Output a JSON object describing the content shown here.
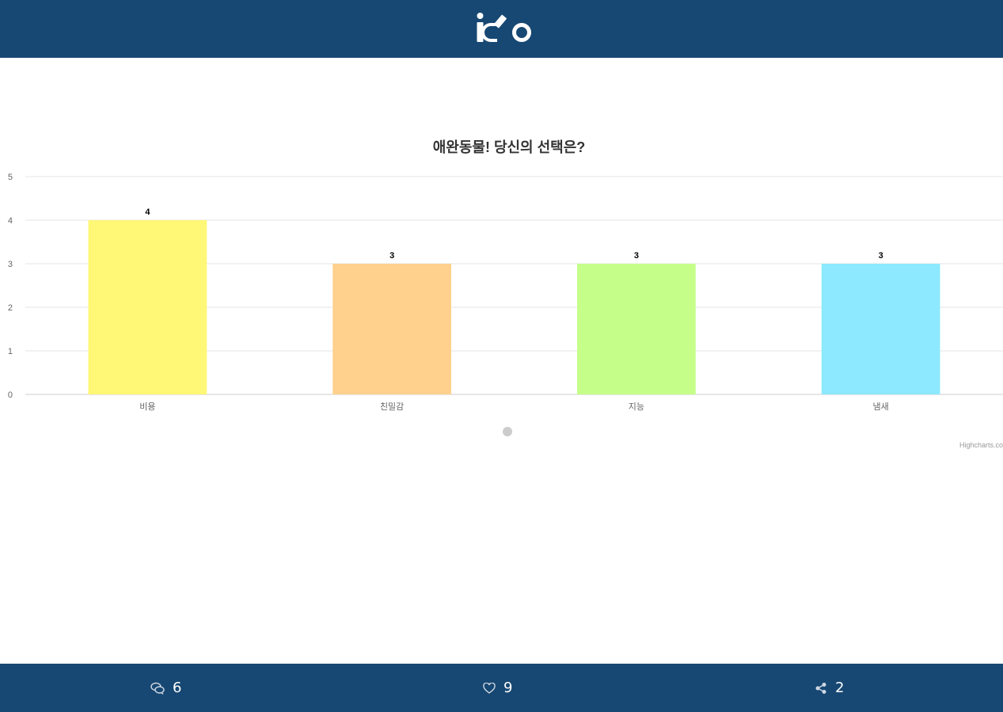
{
  "header": {
    "brand_color": "#174873"
  },
  "footer": {
    "comments_count": "6",
    "likes_count": "9",
    "shares_count": "2",
    "icons": [
      "chat-bubbles-icon",
      "heart-icon",
      "share-icon"
    ]
  },
  "chart_data": {
    "type": "bar",
    "title": "애완동물! 당신의 선택은?",
    "categories": [
      "비용",
      "친밀감",
      "지능",
      "냄새"
    ],
    "values": [
      4,
      3,
      3,
      3
    ],
    "colors": [
      "#FFF776",
      "#FFD18C",
      "#C5FF8A",
      "#8CE9FF"
    ],
    "ylim": [
      0,
      5
    ],
    "yticks": [
      0,
      1,
      2,
      3,
      4,
      5
    ],
    "grid": true,
    "credit": "Highcharts.co"
  }
}
